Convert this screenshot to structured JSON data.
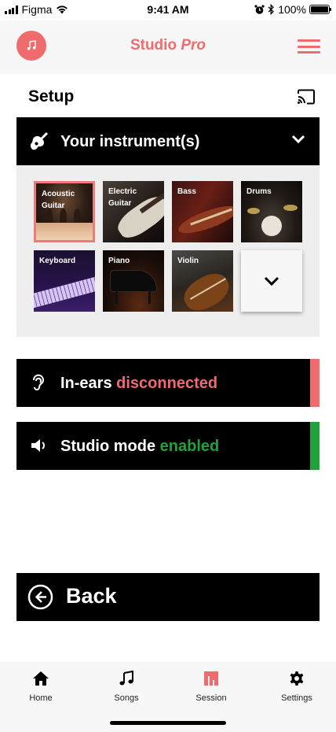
{
  "status_bar": {
    "carrier": "Figma",
    "time": "9:41 AM",
    "battery": "100%"
  },
  "header": {
    "brand_main": "Studio",
    "brand_accent": "Pro"
  },
  "setup": {
    "title": "Setup"
  },
  "instruments_panel": {
    "title": "Your instrument(s)",
    "selected": "Acoustic Guitar",
    "items": [
      {
        "label": "Acoustic Guitar"
      },
      {
        "label": "Electric Guitar"
      },
      {
        "label": "Bass"
      },
      {
        "label": "Drums"
      },
      {
        "label": "Keyboard"
      },
      {
        "label": "Piano"
      },
      {
        "label": "Violin"
      }
    ]
  },
  "in_ears": {
    "label": "In-ears",
    "status": "disconnected",
    "status_color": "#f06b6e"
  },
  "studio_mode": {
    "label": "Studio mode",
    "status": "enabled",
    "status_color": "#1fa23a"
  },
  "back": {
    "label": "Back"
  },
  "tabs": [
    {
      "label": "Home",
      "icon": "home-icon"
    },
    {
      "label": "Songs",
      "icon": "music-note-icon"
    },
    {
      "label": "Session",
      "icon": "session-icon",
      "active": true
    },
    {
      "label": "Settings",
      "icon": "gear-icon"
    }
  ],
  "colors": {
    "accent": "#f06b6e",
    "enabled": "#1fa23a",
    "panel": "#000000"
  }
}
